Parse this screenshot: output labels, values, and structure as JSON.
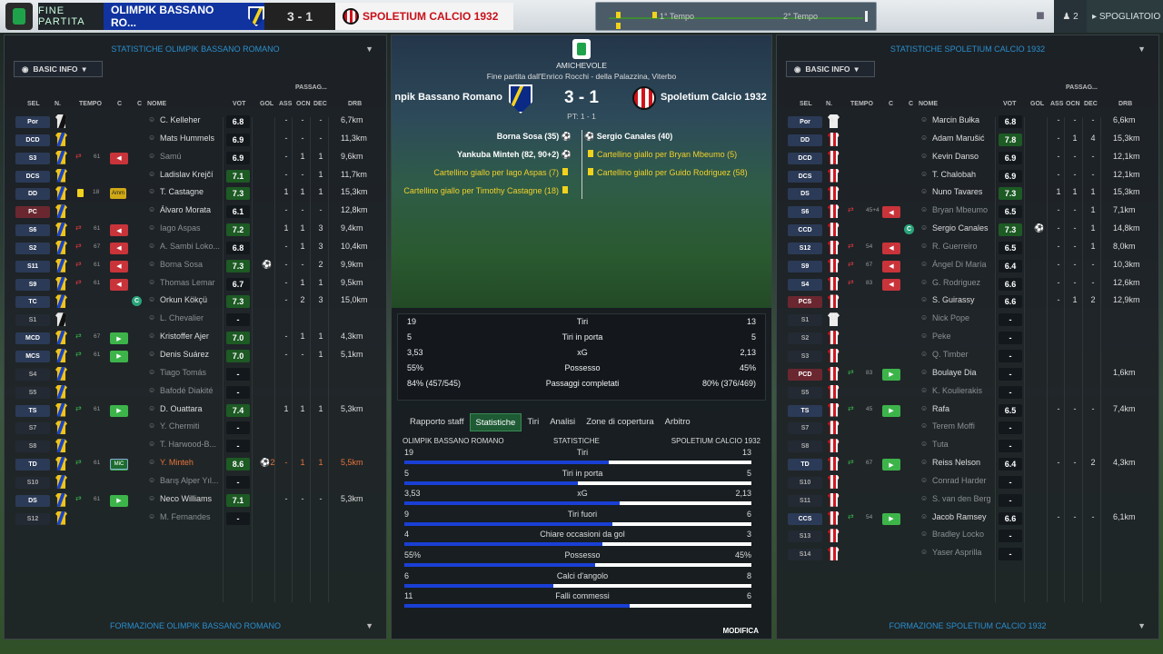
{
  "topbar": {
    "fine": "FINE PARTITA",
    "home": "OLIMPIK BASSANO RO...",
    "score": "3 - 1",
    "away": "SPOLETIUM CALCIO 1932",
    "t1": "1° Tempo",
    "t2": "2° Tempo",
    "users": "2",
    "spogliatoio": "SPOGLIATOIO"
  },
  "left": {
    "title": "STATISTICHE OLIMPIK BASSANO ROMANO",
    "basic": "BASIC INFO",
    "footer": "FORMAZIONE OLIMPIK BASSANO ROMANO",
    "hdr": {
      "sel": "SEL",
      "n": "N.",
      "tempo": "TEMPO",
      "c1": "C",
      "c2": "C",
      "nome": "NOME",
      "vot": "VOT",
      "gol": "GOL",
      "ass": "ASS",
      "passaggi": "PASSAG...",
      "ocn": "OCN",
      "dec": "DEC",
      "drb": "DRB"
    },
    "rows": [
      {
        "pos": "Por",
        "kit": "gk",
        "name": "C. Kelleher",
        "vot": "6.8",
        "gol": "",
        "ass": "-",
        "ocn": "-",
        "dec": "-",
        "drb": "6,7km"
      },
      {
        "pos": "DCD",
        "kit": "bos",
        "name": "Mats Hummels",
        "vot": "6.9",
        "gol": "",
        "ass": "-",
        "ocn": "-",
        "dec": "-",
        "drb": "11,3km"
      },
      {
        "pos": "S3",
        "kit": "bos",
        "name": "Samú",
        "vot": "6.9",
        "gol": "",
        "ass": "-",
        "ocn": "1",
        "dec": "1",
        "drb": "9,6km",
        "sub": "out",
        "min": "61",
        "dim": true
      },
      {
        "pos": "DCS",
        "kit": "bos",
        "name": "Ladislav Krejčí",
        "vot": "7.1",
        "gol": "",
        "ass": "-",
        "ocn": "-",
        "dec": "1",
        "drb": "11,7km"
      },
      {
        "pos": "DD",
        "kit": "bos",
        "name": "T. Castagne",
        "vot": "7.3",
        "gol": "",
        "ass": "1",
        "ocn": "1",
        "dec": "1",
        "drb": "15,3km",
        "card": "18",
        "amm": "Amm"
      },
      {
        "pos": "PC",
        "kit": "bos",
        "name": "Álvaro Morata",
        "vot": "6.1",
        "gol": "",
        "ass": "-",
        "ocn": "-",
        "dec": "-",
        "drb": "12,8km",
        "red": true
      },
      {
        "pos": "S6",
        "kit": "bos",
        "name": "Iago Aspas",
        "vot": "7.2",
        "gol": "",
        "ass": "1",
        "ocn": "1",
        "dec": "3",
        "drb": "9,4km",
        "sub": "out",
        "min": "61",
        "dim": true
      },
      {
        "pos": "S2",
        "kit": "bos",
        "name": "A. Sambi Loko...",
        "vot": "6.8",
        "gol": "",
        "ass": "-",
        "ocn": "1",
        "dec": "3",
        "drb": "10,4km",
        "sub": "out",
        "min": "67",
        "dim": true
      },
      {
        "pos": "S11",
        "kit": "bos",
        "name": "Borna Sosa",
        "vot": "7.3",
        "gol": "ball",
        "ass": "-",
        "ocn": "-",
        "dec": "2",
        "drb": "9,9km",
        "sub": "out",
        "min": "61",
        "dim": true
      },
      {
        "pos": "S9",
        "kit": "bos",
        "name": "Thomas Lemar",
        "vot": "6.7",
        "gol": "",
        "ass": "-",
        "ocn": "1",
        "dec": "1",
        "drb": "9,5km",
        "sub": "out",
        "min": "61",
        "dim": true
      },
      {
        "pos": "TC",
        "kit": "bos",
        "name": "Orkun Kökçü",
        "vot": "7.3",
        "gol": "",
        "ass": "-",
        "ocn": "2",
        "dec": "3",
        "drb": "15,0km",
        "cap": true
      },
      {
        "pos": "S1",
        "kit": "gk",
        "name": "L. Chevalier",
        "vot": "-",
        "gol": "",
        "ass": "",
        "ocn": "",
        "dec": "",
        "drb": "",
        "namedim": true
      },
      {
        "pos": "MCD",
        "kit": "bos",
        "name": "Kristoffer Ajer",
        "vot": "7.0",
        "gol": "",
        "ass": "-",
        "ocn": "1",
        "dec": "1",
        "drb": "4,3km",
        "sub": "in",
        "min": "67"
      },
      {
        "pos": "MCS",
        "kit": "bos",
        "name": "Denis Suárez",
        "vot": "7.0",
        "gol": "",
        "ass": "-",
        "ocn": "-",
        "dec": "1",
        "drb": "5,1km",
        "sub": "in",
        "min": "61"
      },
      {
        "pos": "S4",
        "kit": "bos",
        "name": "Tiago Tomás",
        "vot": "-",
        "gol": "",
        "ass": "",
        "ocn": "",
        "dec": "",
        "drb": "",
        "namedim": true
      },
      {
        "pos": "S5",
        "kit": "bos",
        "name": "Bafodé Diakité",
        "vot": "-",
        "gol": "",
        "ass": "",
        "ocn": "",
        "dec": "",
        "drb": "",
        "namedim": true
      },
      {
        "pos": "TS",
        "kit": "bos",
        "name": "D. Ouattara",
        "vot": "7.4",
        "gol": "",
        "ass": "1",
        "ocn": "1",
        "dec": "1",
        "drb": "5,3km",
        "sub": "in",
        "min": "61"
      },
      {
        "pos": "S7",
        "kit": "bos",
        "name": "Y. Chermiti",
        "vot": "-",
        "gol": "",
        "ass": "",
        "ocn": "",
        "dec": "",
        "drb": "",
        "namedim": true
      },
      {
        "pos": "S8",
        "kit": "bos",
        "name": "T. Harwood-B...",
        "vot": "-",
        "gol": "",
        "ass": "",
        "ocn": "",
        "dec": "",
        "drb": "",
        "namedim": true
      },
      {
        "pos": "TD",
        "kit": "bos",
        "name": "Y. Minteh",
        "vot": "8.6",
        "gol": "ball2",
        "ass": "-",
        "ocn": "1",
        "dec": "1",
        "drb": "5,5km",
        "sub": "in",
        "min": "61",
        "mic": "MiC",
        "orange": true
      },
      {
        "pos": "S10",
        "kit": "bos",
        "name": "Barış Alper Yıl...",
        "vot": "-",
        "gol": "",
        "ass": "",
        "ocn": "",
        "dec": "",
        "drb": "",
        "namedim": true
      },
      {
        "pos": "DS",
        "kit": "bos",
        "name": "Neco Williams",
        "vot": "7.1",
        "gol": "",
        "ass": "-",
        "ocn": "-",
        "dec": "-",
        "drb": "5,3km",
        "sub": "in",
        "min": "61"
      },
      {
        "pos": "S12",
        "kit": "bos",
        "name": "M. Fernandes",
        "vot": "-",
        "gol": "",
        "ass": "",
        "ocn": "",
        "dec": "",
        "drb": "",
        "namedim": true
      }
    ]
  },
  "right": {
    "title": "STATISTICHE SPOLETIUM CALCIO 1932",
    "basic": "BASIC INFO",
    "footer": "FORMAZIONE SPOLETIUM CALCIO 1932",
    "rows": [
      {
        "pos": "Por",
        "kit": "spogk",
        "num": "1",
        "name": "Marcin Bułka",
        "vot": "6.8",
        "ass": "-",
        "ocn": "-",
        "dec": "-",
        "drb": "6,6km"
      },
      {
        "pos": "DD",
        "kit": "spo",
        "name": "Adam Marušić",
        "vot": "7.8",
        "ass": "-",
        "ocn": "1",
        "dec": "4",
        "drb": "15,3km"
      },
      {
        "pos": "DCD",
        "kit": "spo",
        "name": "Kevin Danso",
        "vot": "6.9",
        "ass": "-",
        "ocn": "-",
        "dec": "-",
        "drb": "12,1km"
      },
      {
        "pos": "DCS",
        "kit": "spo",
        "name": "T. Chalobah",
        "vot": "6.9",
        "ass": "-",
        "ocn": "-",
        "dec": "-",
        "drb": "12,1km"
      },
      {
        "pos": "DS",
        "kit": "spo",
        "name": "Nuno Tavares",
        "vot": "7.3",
        "ass": "1",
        "ocn": "1",
        "dec": "1",
        "drb": "15,3km"
      },
      {
        "pos": "S6",
        "kit": "spo",
        "name": "Bryan Mbeumo",
        "vot": "6.5",
        "ass": "-",
        "ocn": "-",
        "dec": "1",
        "drb": "7,1km",
        "sub": "out",
        "min": "45+4",
        "dim": true
      },
      {
        "pos": "CCD",
        "kit": "spo",
        "name": "Sergio Canales",
        "vot": "7.3",
        "gol": "ball",
        "ass": "-",
        "ocn": "-",
        "dec": "1",
        "drb": "14,8km",
        "cap": true
      },
      {
        "pos": "S12",
        "kit": "spo",
        "name": "R. Guerreiro",
        "vot": "6.5",
        "ass": "-",
        "ocn": "-",
        "dec": "1",
        "drb": "8,0km",
        "sub": "out",
        "min": "54",
        "dim": true
      },
      {
        "pos": "S9",
        "kit": "spo",
        "name": "Ángel Di María",
        "vot": "6.4",
        "ass": "-",
        "ocn": "-",
        "dec": "-",
        "drb": "10,3km",
        "sub": "out",
        "min": "67",
        "dim": true
      },
      {
        "pos": "S4",
        "kit": "spo",
        "name": "G. Rodriguez",
        "vot": "6.6",
        "ass": "-",
        "ocn": "-",
        "dec": "-",
        "drb": "12,6km",
        "sub": "out",
        "min": "83",
        "dim": true
      },
      {
        "pos": "PCS",
        "kit": "spo",
        "name": "S. Guirassy",
        "vot": "6.6",
        "ass": "-",
        "ocn": "1",
        "dec": "2",
        "drb": "12,9km",
        "red": true
      },
      {
        "pos": "S1",
        "kit": "spogk",
        "num": "12",
        "name": "Nick Pope",
        "vot": "-",
        "namedim": true
      },
      {
        "pos": "S2",
        "kit": "spo",
        "name": "Peke",
        "vot": "-",
        "namedim": true
      },
      {
        "pos": "S3",
        "kit": "spo",
        "name": "Q. Timber",
        "vot": "-",
        "namedim": true
      },
      {
        "pos": "PCD",
        "kit": "spo",
        "name": "Boulaye Dia",
        "vot": "-",
        "ass": "",
        "ocn": "",
        "dec": "",
        "drb": "1,6km",
        "sub": "in",
        "min": "83",
        "red": true
      },
      {
        "pos": "S5",
        "kit": "spo",
        "name": "K. Koulierakis",
        "vot": "-",
        "namedim": true
      },
      {
        "pos": "TS",
        "kit": "spo",
        "name": "Rafa",
        "vot": "6.5",
        "ass": "-",
        "ocn": "-",
        "dec": "-",
        "drb": "7,4km",
        "sub": "in",
        "min": "45"
      },
      {
        "pos": "S7",
        "kit": "spo",
        "name": "Terem Moffi",
        "vot": "-",
        "namedim": true
      },
      {
        "pos": "S8",
        "kit": "spo",
        "name": "Tuta",
        "vot": "-",
        "namedim": true
      },
      {
        "pos": "TD",
        "kit": "spo",
        "name": "Reiss Nelson",
        "vot": "6.4",
        "ass": "-",
        "ocn": "-",
        "dec": "2",
        "drb": "4,3km",
        "sub": "in",
        "min": "67"
      },
      {
        "pos": "S10",
        "kit": "spo",
        "name": "Conrad Harder",
        "vot": "-",
        "namedim": true
      },
      {
        "pos": "S11",
        "kit": "spo",
        "name": "S. van den Berg",
        "vot": "-",
        "namedim": true
      },
      {
        "pos": "CCS",
        "kit": "spo",
        "name": "Jacob Ramsey",
        "vot": "6.6",
        "ass": "-",
        "ocn": "-",
        "dec": "-",
        "drb": "6,1km",
        "sub": "in",
        "min": "54"
      },
      {
        "pos": "S13",
        "kit": "spo",
        "name": "Bradley Locko",
        "vot": "-",
        "namedim": true
      },
      {
        "pos": "S14",
        "kit": "spo",
        "name": "Yaser Asprilla",
        "vot": "-",
        "namedim": true
      }
    ]
  },
  "center": {
    "amichevole": "AMICHEVOLE",
    "subtitle": "Fine partita dall'Enrico Rocchi - della Palazzina, Viterbo",
    "home": "npik Bassano Romano",
    "away": "Spoletium Calcio 1932",
    "score": "3 - 1",
    "pt": "PT: 1 - 1",
    "events_left": [
      "Borna Sosa (35)",
      "Yankuba Minteh (82, 90+2)",
      "Cartellino giallo per Iago Aspas (7)",
      "Cartellino giallo per Timothy Castagne (18)"
    ],
    "events_right": [
      "Sergio Canales (40)",
      "Cartellino giallo per Bryan Mbeumo (5)",
      "Cartellino giallo per Guido Rodriguez (58)"
    ],
    "summary": [
      {
        "l": "19",
        "m": "Tiri",
        "r": "13"
      },
      {
        "l": "5",
        "m": "Tiri in porta",
        "r": "5"
      },
      {
        "l": "3,53",
        "m": "xG",
        "r": "2,13"
      },
      {
        "l": "55%",
        "m": "Possesso",
        "r": "45%"
      },
      {
        "l": "84% (457/545)",
        "m": "Passaggi completati",
        "r": "80% (376/469)"
      }
    ],
    "tabs": [
      "Rapporto staff",
      "Statistiche",
      "Tiri",
      "Analisi",
      "Zone di copertura",
      "Arbitro"
    ],
    "stat_hdr": {
      "l": "OLIMPIK BASSANO ROMANO",
      "m": "STATISTICHE",
      "r": "SPOLETIUM CALCIO 1932"
    },
    "bars": [
      {
        "l": "19",
        "m": "Tiri",
        "r": "13",
        "frac": 0.59
      },
      {
        "l": "5",
        "m": "Tiri in porta",
        "r": "5",
        "frac": 0.5
      },
      {
        "l": "3,53",
        "m": "xG",
        "r": "2,13",
        "frac": 0.62
      },
      {
        "l": "9",
        "m": "Tiri fuori",
        "r": "6",
        "frac": 0.6
      },
      {
        "l": "4",
        "m": "Chiare occasioni da gol",
        "r": "3",
        "frac": 0.57
      },
      {
        "l": "55%",
        "m": "Possesso",
        "r": "45%",
        "frac": 0.55
      },
      {
        "l": "6",
        "m": "Calci d'angolo",
        "r": "8",
        "frac": 0.43
      },
      {
        "l": "11",
        "m": "Falli commessi",
        "r": "6",
        "frac": 0.65
      }
    ],
    "modifica": "MODIFICA"
  }
}
